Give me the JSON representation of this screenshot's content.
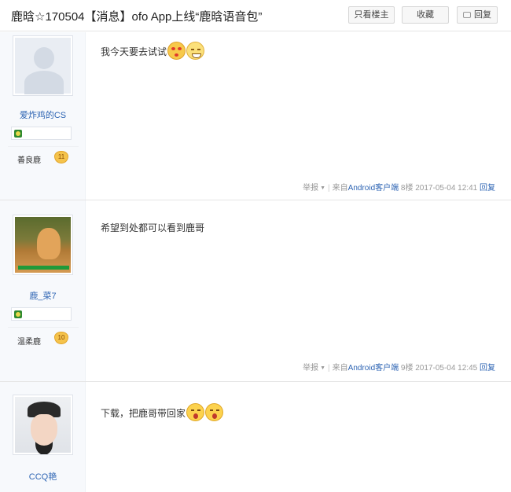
{
  "header": {
    "title": "鹿晗☆170504【消息】ofo App上线“鹿晗语音包”",
    "only_op_label": "只看楼主",
    "favorite_label": "收藏",
    "reply_label": "回复"
  },
  "posts": [
    {
      "username": "爱炸鸡的CS",
      "rank": "善良鹿",
      "level": "11",
      "content": "我今天要去试试",
      "emojis": [
        "kiss-face-icon",
        "grin-face-icon"
      ],
      "report_label": "举报",
      "source_prefix": "来自",
      "source_client": "Android客户端",
      "floor": "8楼",
      "time": "2017-05-04 12:41",
      "reply_label": "回复"
    },
    {
      "username": "鹿_菜7",
      "rank": "温柔鹿",
      "level": "10",
      "content": "希望到处都可以看到鹿哥",
      "emojis": [],
      "report_label": "举报",
      "source_prefix": "来自",
      "source_client": "Android客户端",
      "floor": "9楼",
      "time": "2017-05-04 12:45",
      "reply_label": "回复"
    },
    {
      "username": "CCQ艳",
      "content": "下载，把鹿哥带回家",
      "emojis": [
        "yawn-face-icon",
        "yawn-face-icon"
      ]
    }
  ]
}
